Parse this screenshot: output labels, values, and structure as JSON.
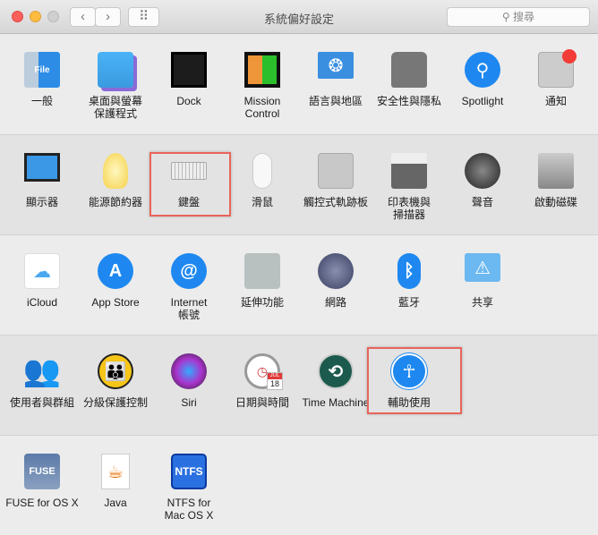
{
  "window": {
    "title": "系統偏好設定",
    "search_placeholder": "搜尋",
    "back_icon": "‹",
    "forward_icon": "›",
    "grid_icon": "⠿"
  },
  "sections": [
    {
      "items": [
        {
          "label": "一般",
          "icon": "general-icon"
        },
        {
          "label": "桌面與螢幕\n保護程式",
          "icon": "desktop-icon"
        },
        {
          "label": "Dock",
          "icon": "dock-icon"
        },
        {
          "label": "Mission\nControl",
          "icon": "mission-control-icon"
        },
        {
          "label": "語言與地區",
          "icon": "flag-icon"
        },
        {
          "label": "安全性與隱私",
          "icon": "security-house-icon"
        },
        {
          "label": "Spotlight",
          "icon": "spotlight-icon"
        },
        {
          "label": "通知",
          "icon": "notifications-icon"
        }
      ]
    },
    {
      "items": [
        {
          "label": "顯示器",
          "icon": "display-icon"
        },
        {
          "label": "能源節約器",
          "icon": "lightbulb-icon"
        },
        {
          "label": "鍵盤",
          "icon": "keyboard-icon",
          "highlighted": true
        },
        {
          "label": "滑鼠",
          "icon": "mouse-icon"
        },
        {
          "label": "觸控式軌跡板",
          "icon": "trackpad-icon"
        },
        {
          "label": "印表機與\n掃描器",
          "icon": "printer-icon"
        },
        {
          "label": "聲音",
          "icon": "speaker-icon"
        },
        {
          "label": "啟動磁碟",
          "icon": "hard-disk-icon"
        }
      ]
    },
    {
      "items": [
        {
          "label": "iCloud",
          "icon": "icloud-icon"
        },
        {
          "label": "App Store",
          "icon": "app-store-icon"
        },
        {
          "label": "Internet\n帳號",
          "icon": "internet-accounts-icon"
        },
        {
          "label": "延伸功能",
          "icon": "puzzle-icon"
        },
        {
          "label": "網路",
          "icon": "network-globe-icon"
        },
        {
          "label": "藍牙",
          "icon": "bluetooth-icon"
        },
        {
          "label": "共享",
          "icon": "sharing-folder-icon"
        }
      ]
    },
    {
      "items": [
        {
          "label": "使用者與群組",
          "icon": "users-icon"
        },
        {
          "label": "分級保護控制",
          "icon": "parental-controls-icon"
        },
        {
          "label": "Siri",
          "icon": "siri-icon"
        },
        {
          "label": "日期與時間",
          "icon": "clock-calendar-icon",
          "calendar_month": "JUL",
          "calendar_day": "18"
        },
        {
          "label": "Time Machine",
          "icon": "time-machine-icon"
        },
        {
          "label": "輔助使用",
          "icon": "accessibility-icon",
          "highlighted": true
        }
      ]
    },
    {
      "items": [
        {
          "label": "FUSE for OS X",
          "icon": "fuse-drive-icon",
          "icon_text": "FUSE"
        },
        {
          "label": "Java",
          "icon": "java-icon"
        },
        {
          "label": "NTFS for\nMac OS X",
          "icon": "ntfs-icon",
          "icon_text": "NTFS"
        }
      ]
    }
  ],
  "colors": {
    "highlight": "#e8645a",
    "accent": "#1e88f0"
  }
}
